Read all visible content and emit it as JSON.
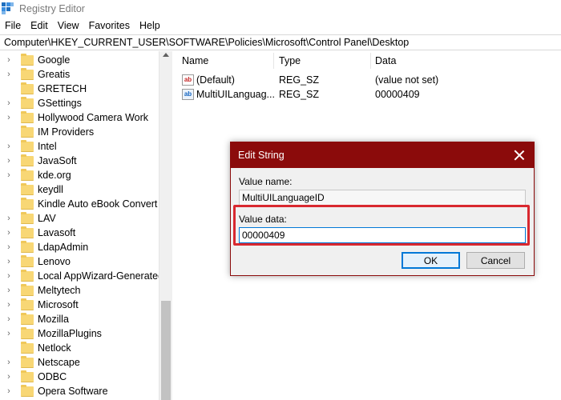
{
  "window": {
    "title": "Registry Editor"
  },
  "menu": [
    "File",
    "Edit",
    "View",
    "Favorites",
    "Help"
  ],
  "address": "Computer\\HKEY_CURRENT_USER\\SOFTWARE\\Policies\\Microsoft\\Control Panel\\Desktop",
  "tree": [
    {
      "label": "Google",
      "expandable": true
    },
    {
      "label": "Greatis",
      "expandable": true
    },
    {
      "label": "GRETECH",
      "expandable": false
    },
    {
      "label": "GSettings",
      "expandable": true
    },
    {
      "label": "Hollywood Camera Work",
      "expandable": true
    },
    {
      "label": "IM Providers",
      "expandable": false
    },
    {
      "label": "Intel",
      "expandable": true
    },
    {
      "label": "JavaSoft",
      "expandable": true
    },
    {
      "label": "kde.org",
      "expandable": true
    },
    {
      "label": "keydll",
      "expandable": false
    },
    {
      "label": "Kindle Auto eBook Convert",
      "expandable": false
    },
    {
      "label": "LAV",
      "expandable": true
    },
    {
      "label": "Lavasoft",
      "expandable": true
    },
    {
      "label": "LdapAdmin",
      "expandable": true
    },
    {
      "label": "Lenovo",
      "expandable": true
    },
    {
      "label": "Local AppWizard-Generated",
      "expandable": true
    },
    {
      "label": "Meltytech",
      "expandable": true
    },
    {
      "label": "Microsoft",
      "expandable": true
    },
    {
      "label": "Mozilla",
      "expandable": true
    },
    {
      "label": "MozillaPlugins",
      "expandable": true
    },
    {
      "label": "Netlock",
      "expandable": false
    },
    {
      "label": "Netscape",
      "expandable": true
    },
    {
      "label": "ODBC",
      "expandable": true
    },
    {
      "label": "Opera Software",
      "expandable": true
    }
  ],
  "list": {
    "columns": {
      "name": "Name",
      "type": "Type",
      "data": "Data"
    },
    "rows": [
      {
        "name": "(Default)",
        "type": "REG_SZ",
        "data": "(value not set)",
        "icon": "string-value-icon"
      },
      {
        "name": "MultiUILanguag...",
        "type": "REG_SZ",
        "data": "00000409",
        "icon": "string-value-icon"
      }
    ]
  },
  "dialog": {
    "title": "Edit String",
    "value_name_label": "Value name:",
    "value_name": "MultiUILanguageID",
    "value_data_label": "Value data:",
    "value_data": "00000409",
    "ok_label": "OK",
    "cancel_label": "Cancel"
  },
  "colors": {
    "dialog_titlebar": "#8b0b0b",
    "highlight": "#d9282f",
    "focus": "#0078d7"
  }
}
